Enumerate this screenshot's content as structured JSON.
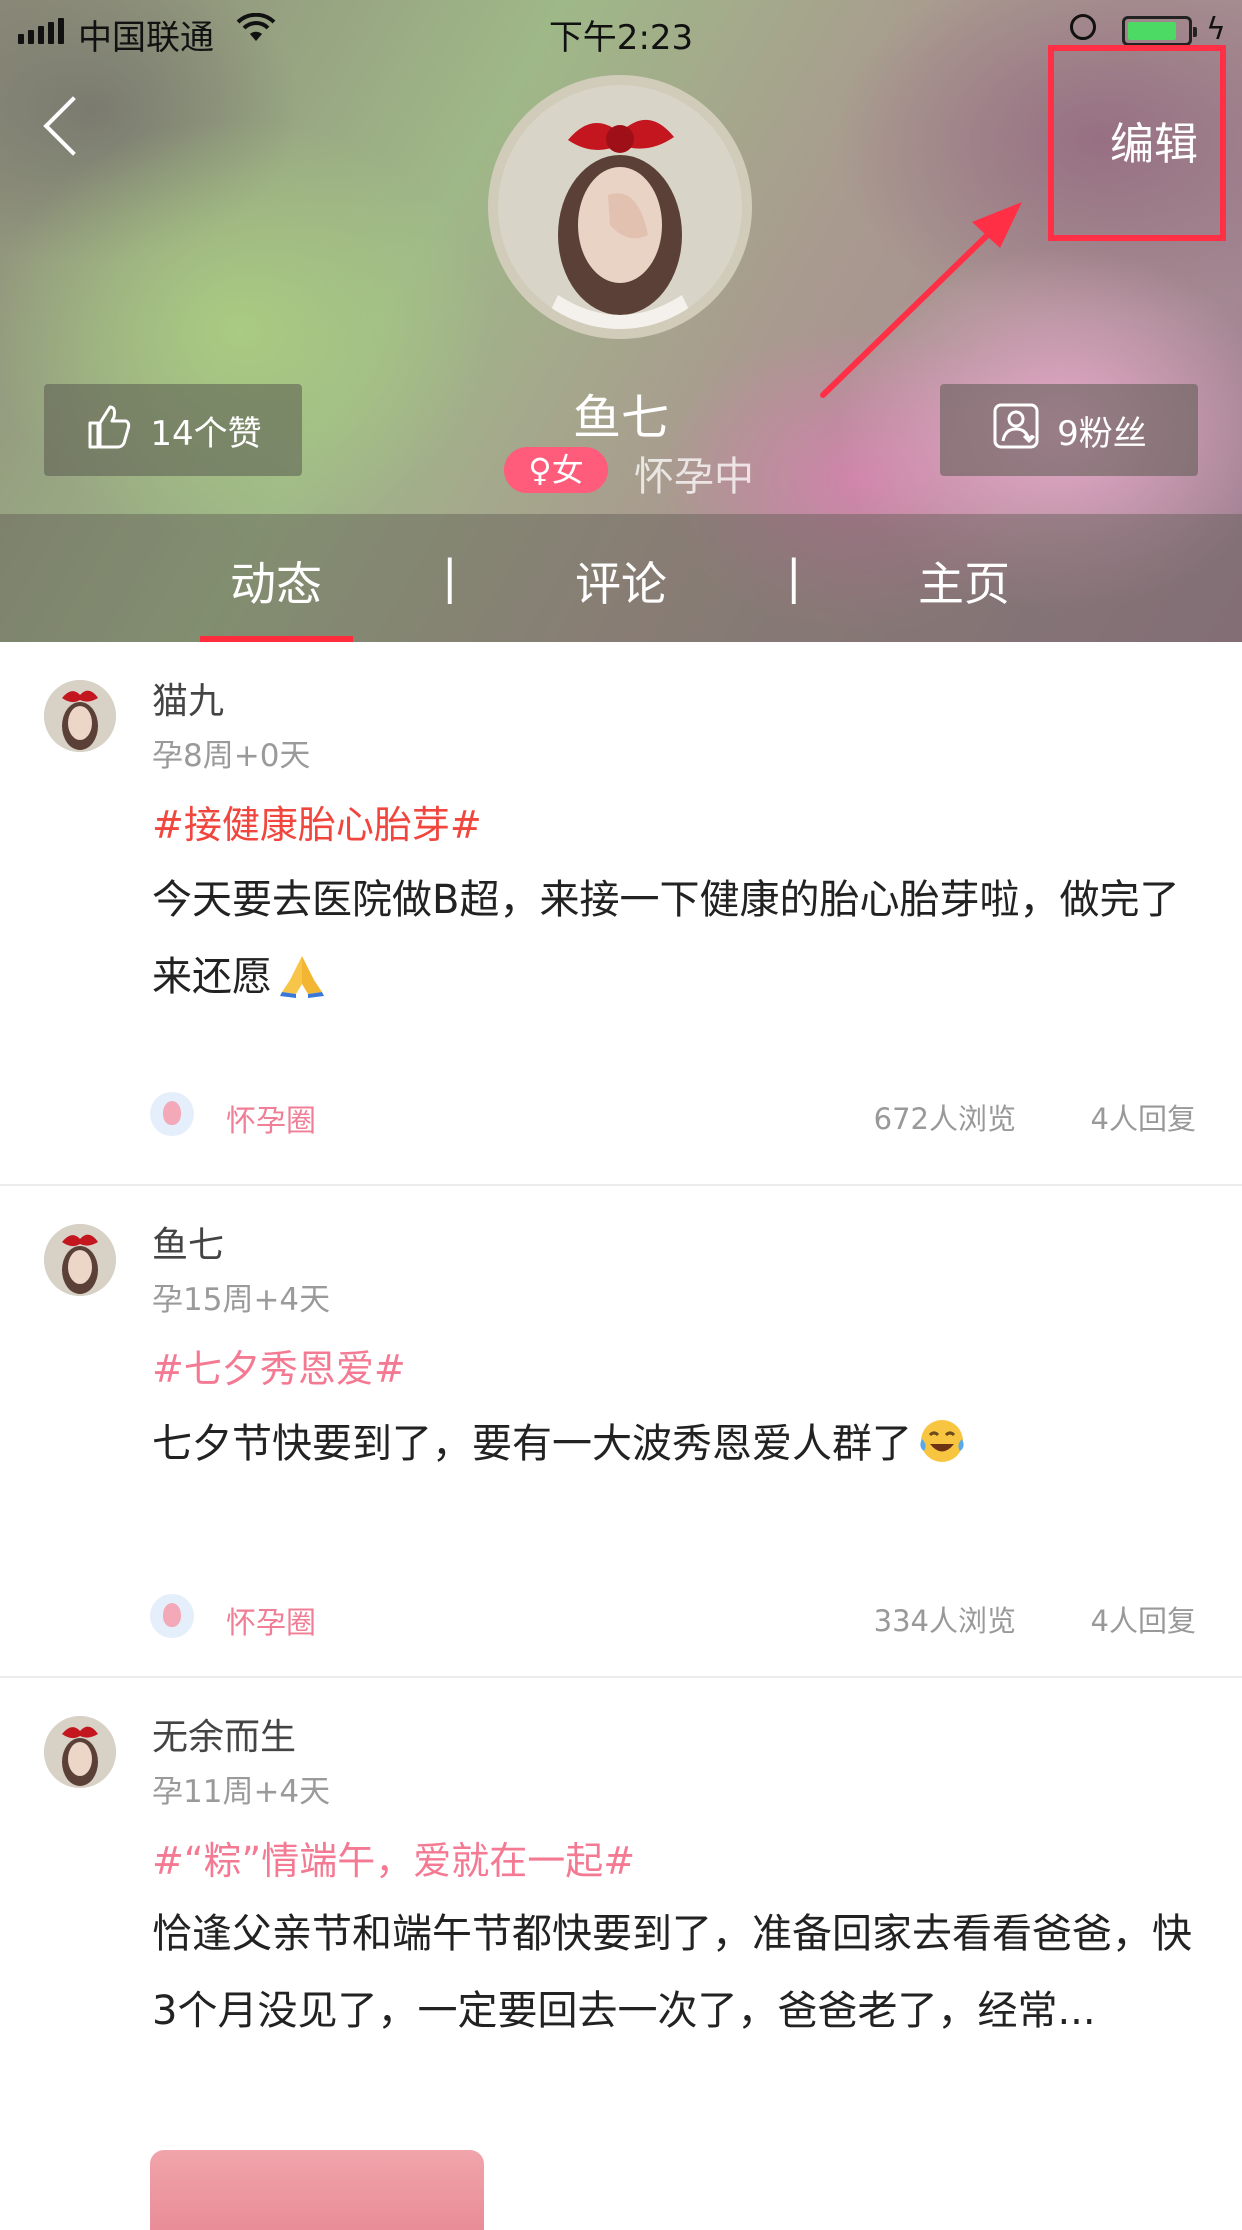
{
  "status_bar": {
    "carrier": "中国联通",
    "time": "下午2:23"
  },
  "header": {
    "edit_label": "编辑",
    "user_name": "鱼七",
    "gender_label": "♀女",
    "status": "怀孕中",
    "likes_label": "14个赞",
    "fans_label": "9粉丝",
    "highlight_color": "#ff2f46"
  },
  "tabs": [
    {
      "label": "动态",
      "active": true
    },
    {
      "label": "评论",
      "active": false
    },
    {
      "label": "主页",
      "active": false
    }
  ],
  "tab_separator": "|",
  "accent_color": "#ff2c3e",
  "posts": [
    {
      "user": "猫九",
      "week": "孕8周+0天",
      "topic": "#接健康胎心胎芽#",
      "topic_color": "#f0463e",
      "body": "今天要去医院做B超，来接一下健康的胎心胎芽啦，做完了来还愿",
      "emoji": "folded-hands-emoji",
      "circle": "怀孕圈",
      "views": "672人浏览",
      "replies": "4人回复"
    },
    {
      "user": "鱼七",
      "week": "孕15周+4天",
      "topic": "#七夕秀恩爱#",
      "topic_color": "#f47a93",
      "body": "七夕节快要到了，要有一大波秀恩爱人群了",
      "emoji": "tears-of-joy-emoji",
      "circle": "怀孕圈",
      "views": "334人浏览",
      "replies": "4人回复"
    },
    {
      "user": "无余而生",
      "week": "孕11周+4天",
      "topic": "#“粽”情端午，爱就在一起#",
      "topic_color": "#f47a93",
      "body": "恰逢父亲节和端午节都快要到了，准备回家去看看爸爸，快3个月没见了，一定要回去一次了，爸爸老了，经常..."
    }
  ]
}
